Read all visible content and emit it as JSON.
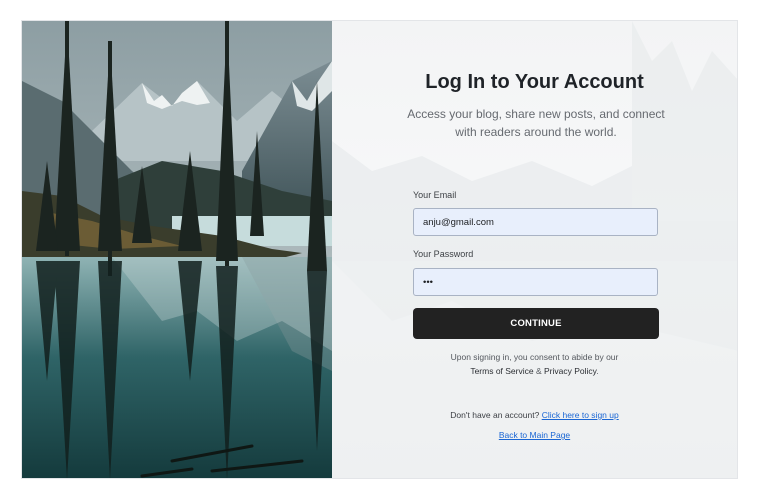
{
  "login": {
    "title": "Log In to Your Account",
    "subtitle": "Access your blog, share new posts, and connect with readers around the world.",
    "email_label": "Your Email",
    "email_value": "anju@gmail.com",
    "password_label": "Your Password",
    "password_value": "abc",
    "continue_label": "CONTINUE",
    "consent_prefix": "Upon signing in, you consent to abide by our",
    "terms_link": "Terms of Service",
    "consent_and": " & ",
    "privacy_link": "Privacy Policy",
    "consent_suffix": ".",
    "signup_prompt": "Don't have an account? ",
    "signup_link": "Click here to sign up",
    "back_link": "Back to Main Page"
  },
  "colors": {
    "button": "#222222",
    "input_bg": "#e8effc",
    "link": "#1a66d4"
  }
}
